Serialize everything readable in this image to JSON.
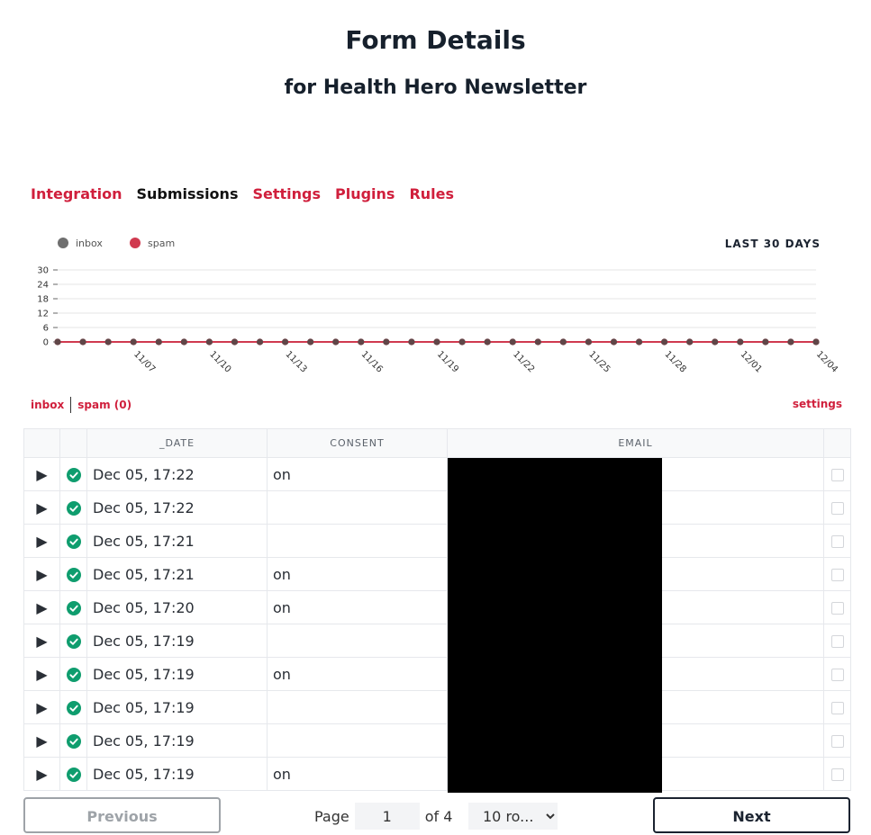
{
  "header": {
    "title": "Form Details",
    "subtitle": "for Health Hero Newsletter"
  },
  "tabs": [
    {
      "label": "Integration",
      "active": false
    },
    {
      "label": "Submissions",
      "active": true
    },
    {
      "label": "Settings",
      "active": false
    },
    {
      "label": "Plugins",
      "active": false
    },
    {
      "label": "Rules",
      "active": false
    }
  ],
  "chart": {
    "range_label": "LAST 30 DAYS"
  },
  "chart_data": {
    "type": "line",
    "title": "",
    "xlabel": "",
    "ylabel": "",
    "ylim": [
      0,
      30
    ],
    "yticks": [
      0,
      6,
      12,
      18,
      24,
      30
    ],
    "xtick_labels": [
      "11/07",
      "11/10",
      "11/13",
      "11/16",
      "11/19",
      "11/22",
      "11/25",
      "11/28",
      "12/01",
      "12/04"
    ],
    "x": [
      "11/04",
      "11/05",
      "11/06",
      "11/07",
      "11/08",
      "11/09",
      "11/10",
      "11/11",
      "11/12",
      "11/13",
      "11/14",
      "11/15",
      "11/16",
      "11/17",
      "11/18",
      "11/19",
      "11/20",
      "11/21",
      "11/22",
      "11/23",
      "11/24",
      "11/25",
      "11/26",
      "11/27",
      "11/28",
      "11/29",
      "11/30",
      "12/01",
      "12/02",
      "12/03",
      "12/04"
    ],
    "series": [
      {
        "name": "inbox",
        "color": "#6f6f6f",
        "values": [
          0,
          0,
          0,
          0,
          0,
          0,
          0,
          0,
          0,
          0,
          0,
          0,
          0,
          0,
          0,
          0,
          0,
          0,
          0,
          0,
          0,
          0,
          0,
          0,
          0,
          0,
          0,
          0,
          0,
          0,
          0
        ]
      },
      {
        "name": "spam",
        "color": "#d03a4f",
        "values": [
          0,
          0,
          0,
          0,
          0,
          0,
          0,
          0,
          0,
          0,
          0,
          0,
          0,
          0,
          0,
          0,
          0,
          0,
          0,
          0,
          0,
          0,
          0,
          0,
          0,
          0,
          0,
          0,
          0,
          0,
          0
        ]
      }
    ],
    "legend_position": "top-left",
    "grid": true
  },
  "filters": {
    "inbox_label": "inbox",
    "spam_label": "spam (0)",
    "settings_label": "settings"
  },
  "table": {
    "columns": [
      "_DATE",
      "CONSENT",
      "EMAIL"
    ],
    "rows": [
      {
        "date": "Dec 05, 17:22",
        "consent": "on"
      },
      {
        "date": "Dec 05, 17:22",
        "consent": ""
      },
      {
        "date": "Dec 05, 17:21",
        "consent": ""
      },
      {
        "date": "Dec 05, 17:21",
        "consent": "on"
      },
      {
        "date": "Dec 05, 17:20",
        "consent": "on"
      },
      {
        "date": "Dec 05, 17:19",
        "consent": ""
      },
      {
        "date": "Dec 05, 17:19",
        "consent": "on"
      },
      {
        "date": "Dec 05, 17:19",
        "consent": ""
      },
      {
        "date": "Dec 05, 17:19",
        "consent": ""
      },
      {
        "date": "Dec 05, 17:19",
        "consent": "on"
      }
    ]
  },
  "pagination": {
    "previous_label": "Previous",
    "next_label": "Next",
    "page_label": "Page",
    "page_value": "1",
    "of_label": "of 4",
    "rows_option": "10 ro..."
  },
  "colors": {
    "accent": "#d01f3c",
    "success": "#0f9d6e",
    "text_dark": "#16202c"
  }
}
